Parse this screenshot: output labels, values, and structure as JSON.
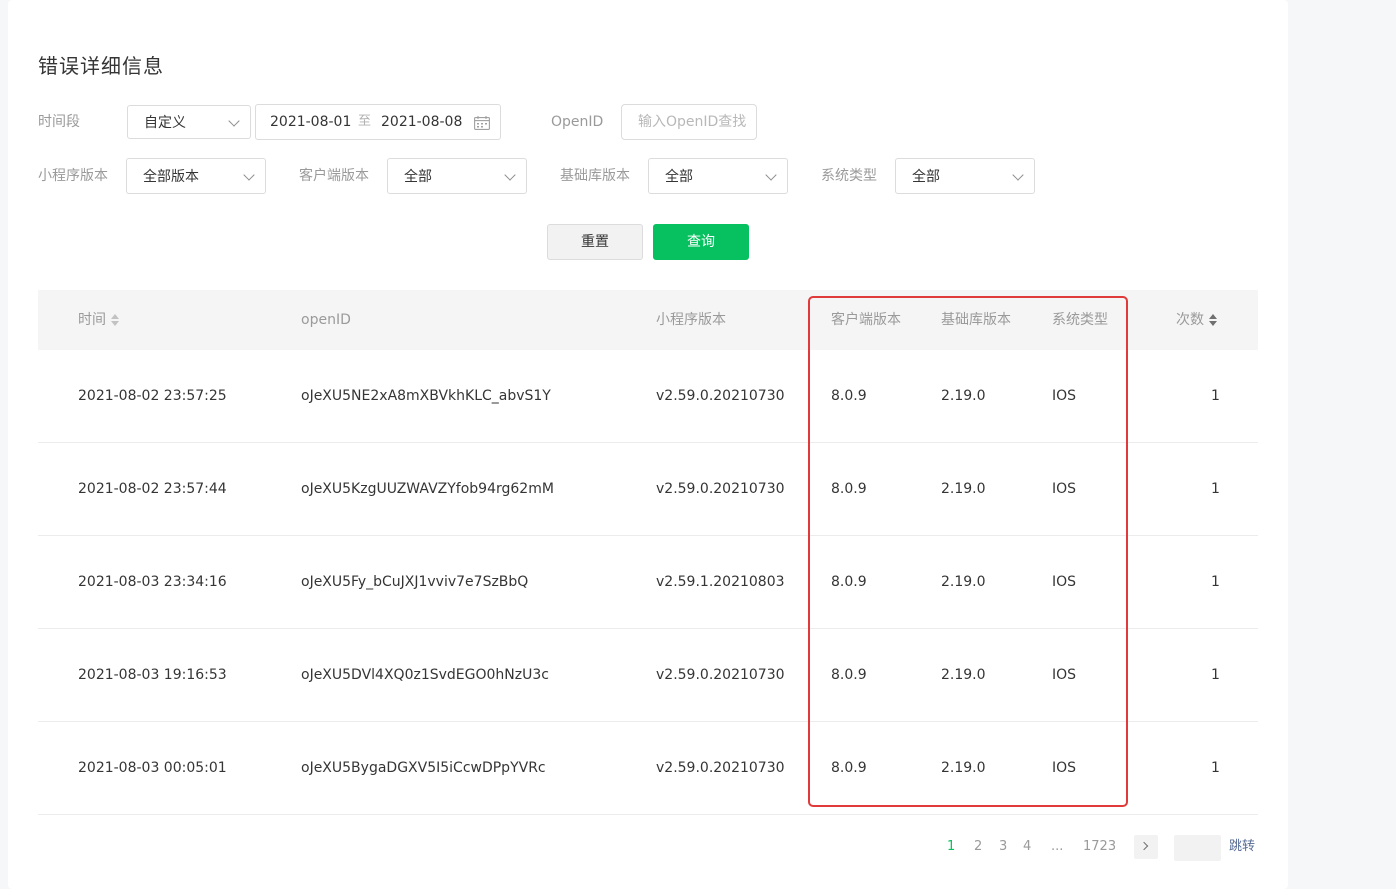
{
  "page": {
    "title": "错误详细信息"
  },
  "filters": {
    "time_label": "时间段",
    "time_mode": "自定义",
    "date_start": "2021-08-01",
    "date_sep": "至",
    "date_end": "2021-08-08",
    "openid_label": "OpenID",
    "openid_placeholder": "输入OpenID查找",
    "openid_value": "",
    "mini_version_label": "小程序版本",
    "mini_version_value": "全部版本",
    "client_version_label": "客户端版本",
    "client_version_value": "全部",
    "base_lib_label": "基础库版本",
    "base_lib_value": "全部",
    "os_label": "系统类型",
    "os_value": "全部"
  },
  "actions": {
    "reset_label": "重置",
    "query_label": "查询"
  },
  "table": {
    "columns": [
      "时间",
      "openID",
      "小程序版本",
      "客户端版本",
      "基础库版本",
      "系统类型",
      "次数"
    ],
    "rows": [
      [
        "2021-08-02 23:57:25",
        "oJeXU5NE2xA8mXBVkhKLC_abvS1Y",
        "v2.59.0.20210730",
        "8.0.9",
        "2.19.0",
        "IOS",
        "1"
      ],
      [
        "2021-08-02 23:57:44",
        "oJeXU5KzgUUZWAVZYfob94rg62mM",
        "v2.59.0.20210730",
        "8.0.9",
        "2.19.0",
        "IOS",
        "1"
      ],
      [
        "2021-08-03 23:34:16",
        "oJeXU5Fy_bCuJXJ1vviv7e7SzBbQ",
        "v2.59.1.20210803",
        "8.0.9",
        "2.19.0",
        "IOS",
        "1"
      ],
      [
        "2021-08-03 19:16:53",
        "oJeXU5DVl4XQ0z1SvdEGO0hNzU3c",
        "v2.59.0.20210730",
        "8.0.9",
        "2.19.0",
        "IOS",
        "1"
      ],
      [
        "2021-08-03 00:05:01",
        "oJeXU5BygaDGXV5I5iCcwDPpYVRc",
        "v2.59.0.20210730",
        "8.0.9",
        "2.19.0",
        "IOS",
        "1"
      ]
    ]
  },
  "pagination": {
    "pages": [
      "1",
      "2",
      "3",
      "4"
    ],
    "current": "1",
    "ellipsis": "...",
    "last": "1723",
    "next_icon": "chevron-right-icon",
    "jump_value": "",
    "jump_label": "跳转"
  },
  "colors": {
    "accent": "#07c160",
    "highlight_box": "#e03a3a",
    "link": "#576b95"
  }
}
